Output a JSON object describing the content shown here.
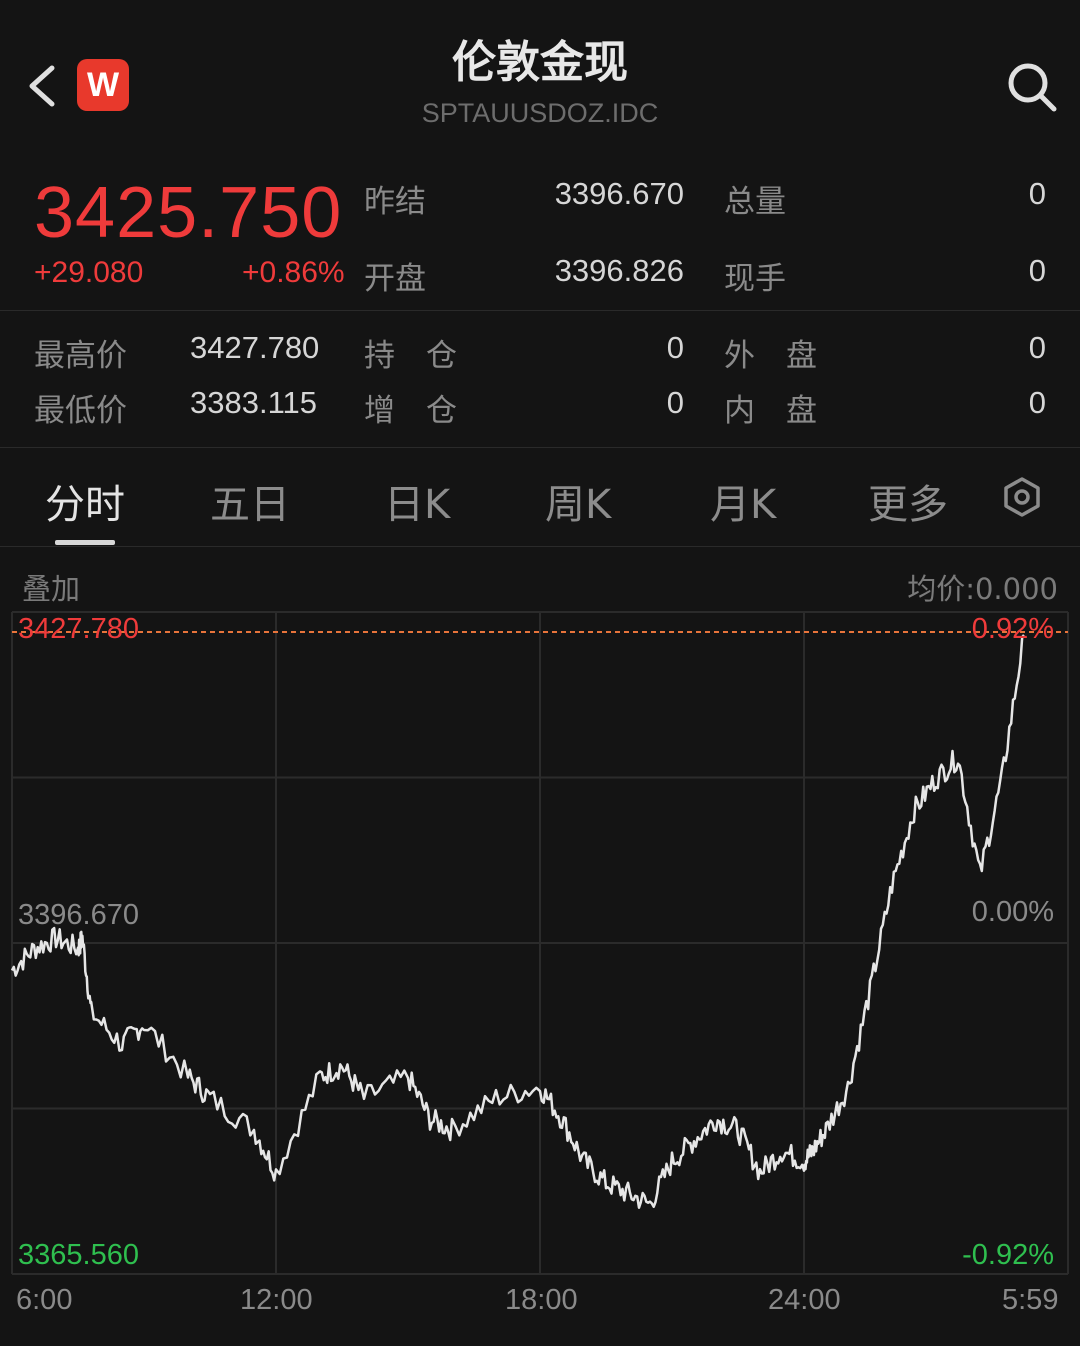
{
  "header": {
    "title": "伦敦金现",
    "subtitle": "SPTAUUSDOZ.IDC",
    "logo_letter": "W",
    "back_icon": "chevron-left-icon",
    "search_icon": "search-icon"
  },
  "quote": {
    "price": "3425.750",
    "change": "+29.080",
    "change_pct": "+0.86%",
    "prev_settle_label": "昨结",
    "prev_settle": "3396.670",
    "open_label": "开盘",
    "open": "3396.826",
    "volume_label": "总量",
    "volume": "0",
    "last_hand_label": "现手",
    "last_hand": "0",
    "high_label": "最高价",
    "high": "3427.780",
    "low_label": "最低价",
    "low": "3383.115",
    "position_label": "持　仓",
    "position": "0",
    "add_position_label": "增　仓",
    "add_position": "0",
    "outer_label": "外　盘",
    "outer": "0",
    "inner_label": "内　盘",
    "inner": "0"
  },
  "tabs": [
    "分时",
    "五日",
    "日K",
    "周K",
    "月K",
    "更多"
  ],
  "active_tab": "分时",
  "chart_header": {
    "overlay": "叠加",
    "avg_price": "均价:0.000"
  },
  "colors": {
    "up": "#ef3b3b",
    "down": "#2fbf4f",
    "line": "#e6e6e6",
    "bg": "#141414"
  },
  "chart_data": {
    "type": "line",
    "y_left_ticks": [
      "3427.780",
      "3396.670",
      "3365.560"
    ],
    "y_right_ticks": [
      "0.92%",
      "0.00%",
      "-0.92%"
    ],
    "x_ticks": [
      "6:00",
      "12:00",
      "18:00",
      "24:00",
      "5:59"
    ],
    "ylim": [
      3365.56,
      3427.78
    ],
    "reference_high": 3427.78,
    "x_hours": [
      0,
      0.5,
      1,
      1.5,
      1.6,
      1.8,
      2.5,
      3,
      4,
      4.5,
      5.5,
      6,
      7,
      7.5,
      8,
      9,
      9.5,
      10,
      11,
      12,
      12.5,
      13,
      13.5,
      14,
      14.5,
      15,
      15.5,
      16,
      16.5,
      17,
      17.5,
      18,
      18.2,
      18.5,
      19,
      19.5,
      20,
      20.5,
      21,
      21.5,
      22,
      22.5,
      23
    ],
    "values": [
      3396,
      3398,
      3399,
      3398,
      3399,
      3392,
      3389,
      3391,
      3386,
      3384,
      3381,
      3377,
      3386,
      3387,
      3384,
      3386,
      3382,
      3381,
      3384,
      3385,
      3382,
      3378,
      3376,
      3375,
      3374,
      3378,
      3380,
      3382,
      3381,
      3377,
      3379,
      3378,
      3379,
      3381,
      3385,
      3394,
      3404,
      3411,
      3414,
      3416,
      3405,
      3414,
      3427.5
    ]
  }
}
